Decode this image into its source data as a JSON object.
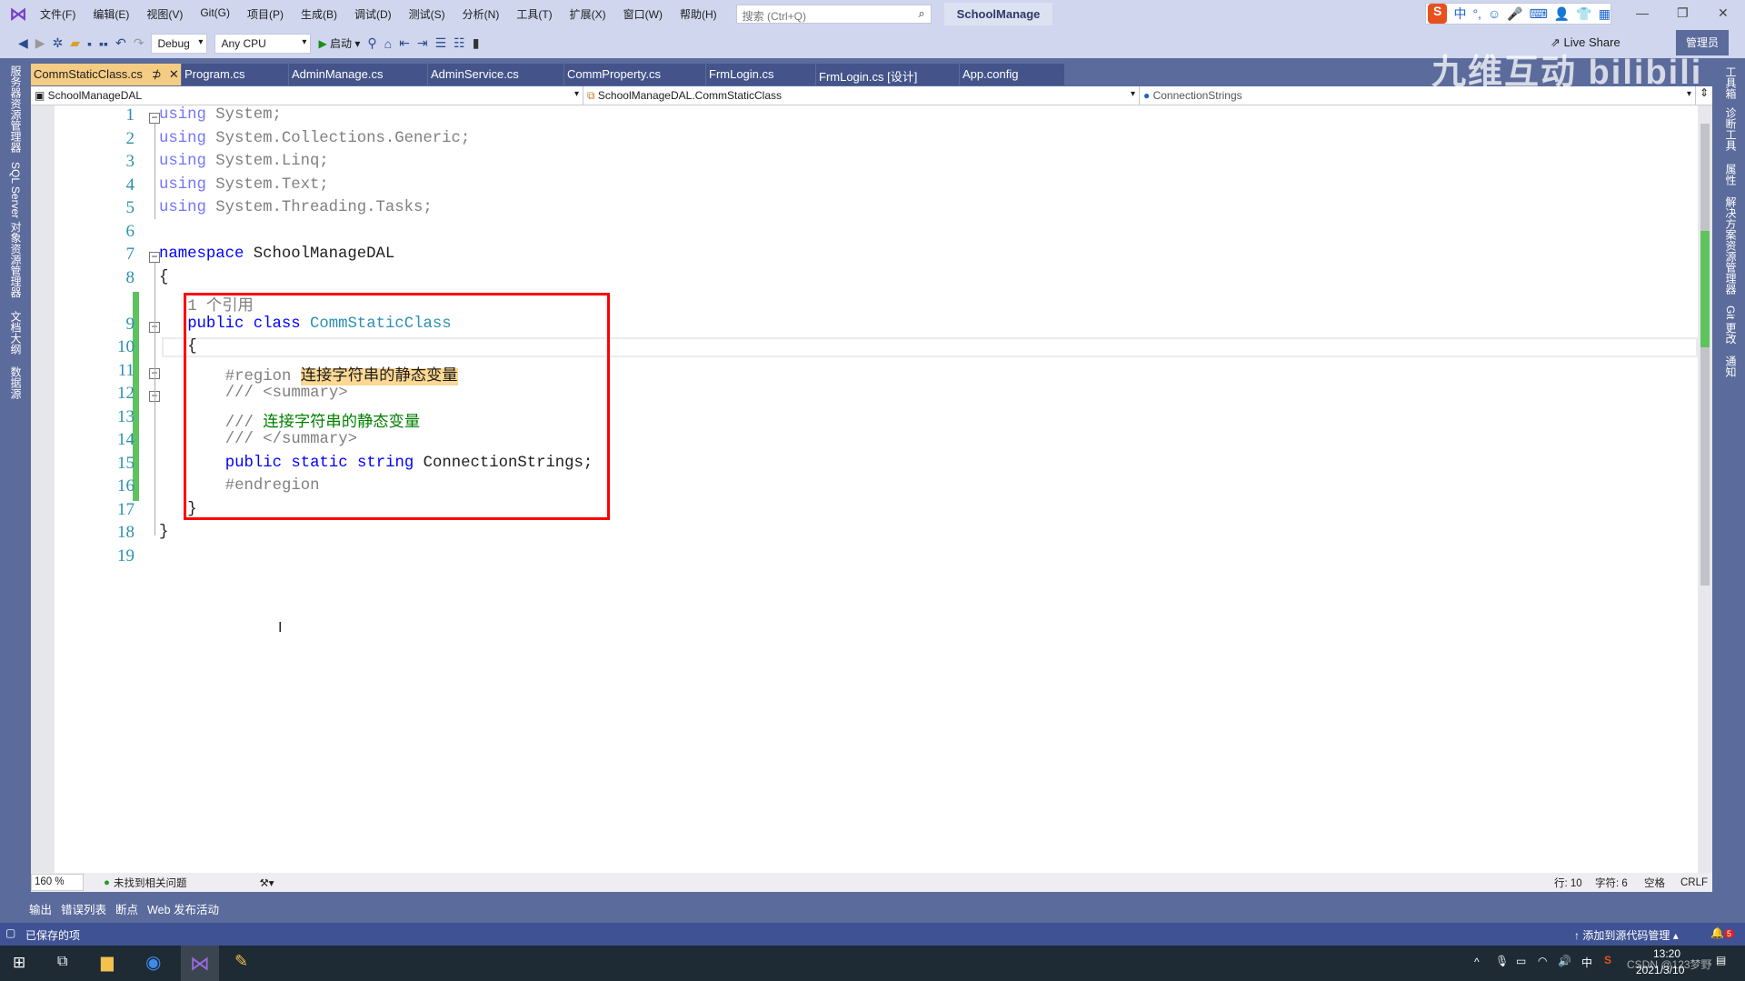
{
  "title_bar": {
    "menus": [
      "文件(F)",
      "编辑(E)",
      "视图(V)",
      "Git(G)",
      "项目(P)",
      "生成(B)",
      "调试(D)",
      "测试(S)",
      "分析(N)",
      "工具(T)",
      "扩展(X)",
      "窗口(W)",
      "帮助(H)"
    ],
    "search_placeholder": "搜索 (Ctrl+Q)",
    "solution_name": "SchoolManage",
    "ime": [
      "中",
      "°,",
      "☺",
      "🎤",
      "⌨",
      "👤",
      "👕",
      "▦"
    ]
  },
  "toolbar": {
    "config": "Debug",
    "platform": "Any CPU",
    "start": "启动",
    "live_share": "Live Share",
    "admin": "管理员"
  },
  "watermark": "九维互动 bilibili",
  "tabs": [
    "CommStaticClass.cs",
    "Program.cs",
    "AdminManage.cs",
    "AdminService.cs",
    "CommProperty.cs",
    "FrmLogin.cs",
    "FrmLogin.cs [设计]",
    "App.config"
  ],
  "navbar": {
    "project": "SchoolManageDAL",
    "class": "SchoolManageDAL.CommStaticClass",
    "member": "ConnectionStrings"
  },
  "left_panels": [
    "服务器资源管理器",
    "SQL Server 对象资源管理器",
    "文档大纲",
    "数据源"
  ],
  "right_panels": [
    "工具箱",
    "诊断工具",
    "属性",
    "解决方案资源管理器",
    "Git 更改",
    "通知"
  ],
  "code": {
    "line_numbers": [
      "1",
      "2",
      "3",
      "4",
      "5",
      "6",
      "7",
      "8",
      "9",
      "10",
      "11",
      "12",
      "13",
      "14",
      "15",
      "16",
      "17",
      "18",
      "19"
    ],
    "using_kw": "using",
    "usings": [
      "System;",
      "System.Collections.Generic;",
      "System.Linq;",
      "System.Text;",
      "System.Threading.Tasks;"
    ],
    "namespace_kw": "namespace",
    "namespace_name": "SchoolManageDAL",
    "open_brace": "{",
    "close_brace": "}",
    "codelens": "1 个引用",
    "public_kw": "public",
    "class_kw": "class",
    "class_name": "CommStaticClass",
    "region_kw": "#region",
    "region_name": "连接字符串的静态变量",
    "doc_prefix": "///",
    "summary_open": "<summary>",
    "summary_text": "连接字符串的静态变量",
    "summary_close": "</summary>",
    "static_kw": "static",
    "string_kw": "string",
    "field": "ConnectionStrings;",
    "endregion": "#endregion"
  },
  "status_strip": {
    "zoom": "160 %",
    "issues": "未找到相关问题",
    "line": "行: 10",
    "char": "字符: 6",
    "spaces": "空格",
    "eol": "CRLF"
  },
  "bottom_tabs": [
    "输出",
    "错误列表",
    "断点",
    "Web 发布活动"
  ],
  "status_bar": {
    "left": "已保存的项",
    "source_control": "添加到源代码管理",
    "notifications": "5"
  },
  "taskbar": {
    "time": "13:20",
    "date": "2021/3/10",
    "ime": "中",
    "credit": "CSDN @123梦野"
  }
}
